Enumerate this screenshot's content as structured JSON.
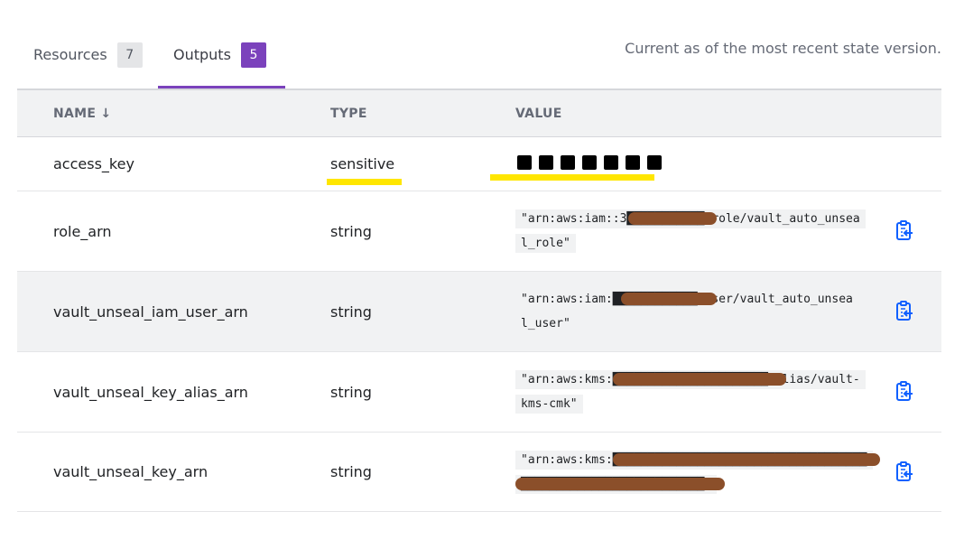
{
  "tabs": {
    "resources": {
      "label": "Resources",
      "count": "7"
    },
    "outputs": {
      "label": "Outputs",
      "count": "5"
    }
  },
  "state_note": "Current as of the most recent state version.",
  "columns": {
    "name": "NAME ↓",
    "type": "TYPE",
    "value": "VALUE"
  },
  "rows": [
    {
      "name": "access_key",
      "type": "sensitive",
      "value": ""
    },
    {
      "name": "role_arn",
      "type": "string",
      "value": "\"arn:aws:iam::3",
      "value_line1": "\"arn:aws:iam::3███████████:role/vault_auto_unsea",
      "value_line2": "l_role\""
    },
    {
      "name": "vault_unseal_iam_user_arn",
      "type": "string",
      "value_line1": "\"arn:aws:iam:████████████:user/vault_auto_unsea",
      "value_line2": "l_user\""
    },
    {
      "name": "vault_unseal_key_alias_arn",
      "type": "string",
      "value_line1": "\"arn:aws:kms:██████████████████████:alias/vault-",
      "value_line2": "kms-cmk\""
    },
    {
      "name": "vault_unseal_key_arn",
      "type": "string",
      "value_line1": "\"arn:aws:kms:████████████████████████████████████",
      "value_line2": "██████████████████████████\""
    }
  ],
  "colors": {
    "accent": "#7b42bc",
    "highlight": "#ffe600",
    "redaction": "#8b4f2a",
    "copy_icon": "#1060ff"
  },
  "icons": {
    "copy": "clipboard-copy-icon"
  }
}
